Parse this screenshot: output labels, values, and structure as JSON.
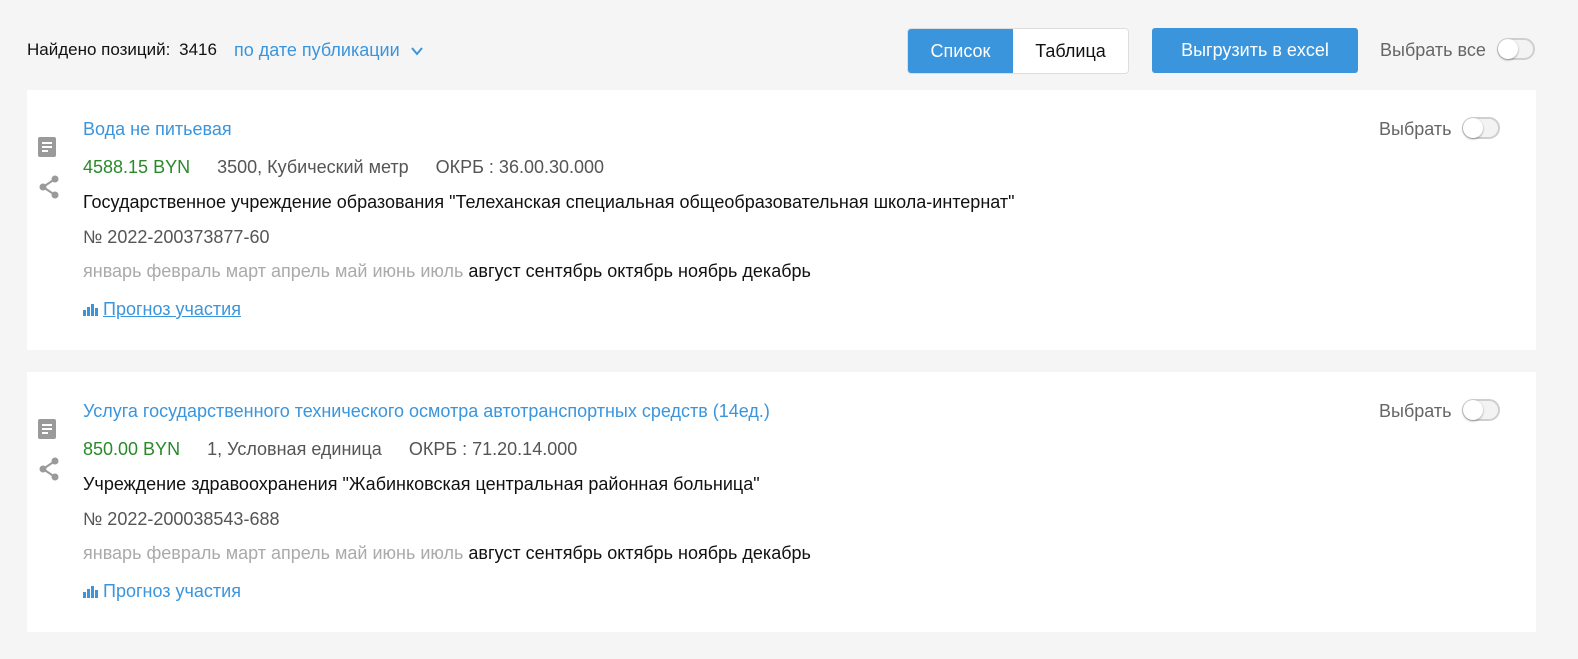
{
  "header": {
    "found_label": "Найдено позиций:",
    "found_count": "3416",
    "sort_label": "по дате публикации",
    "view_list": "Список",
    "view_table": "Таблица",
    "export_label": "Выгрузить в excel",
    "select_all_label": "Выбрать все"
  },
  "items": [
    {
      "title": "Вода не питьевая",
      "select_label": "Выбрать",
      "price": "4588.15 BYN",
      "qty": "3500, Кубический метр",
      "okrb": "ОКРБ : 36.00.30.000",
      "org": "Государственное учреждение образования \"Телеханская специальная общеобразовательная школа-интернат\"",
      "number": "№ 2022-200373877-60",
      "months_inactive": "январь февраль март апрель май июнь июль",
      "months_active": "август сентябрь октябрь ноябрь декабрь",
      "forecast_label": "Прогноз участия"
    },
    {
      "title": "Услуга государственного технического осмотра автотранспортных средств (14ед.)",
      "select_label": "Выбрать",
      "price": "850.00 BYN",
      "qty": "1, Условная единица",
      "okrb": "ОКРБ : 71.20.14.000",
      "org": "Учреждение здравоохранения \"Жабинковская центральная районная больница\"",
      "number": "№ 2022-200038543-688",
      "months_inactive": "январь февраль март апрель май июнь июль",
      "months_active": "август сентябрь октябрь ноябрь декабрь",
      "forecast_label": "Прогноз участия"
    }
  ],
  "colors": {
    "accent": "#3a95dc",
    "price": "#2a8a2a",
    "muted": "#aaaaaa",
    "background": "#f5f5f5"
  },
  "icons": [
    "chevron-down-icon",
    "document-icon",
    "share-icon",
    "bar-chart-icon"
  ]
}
